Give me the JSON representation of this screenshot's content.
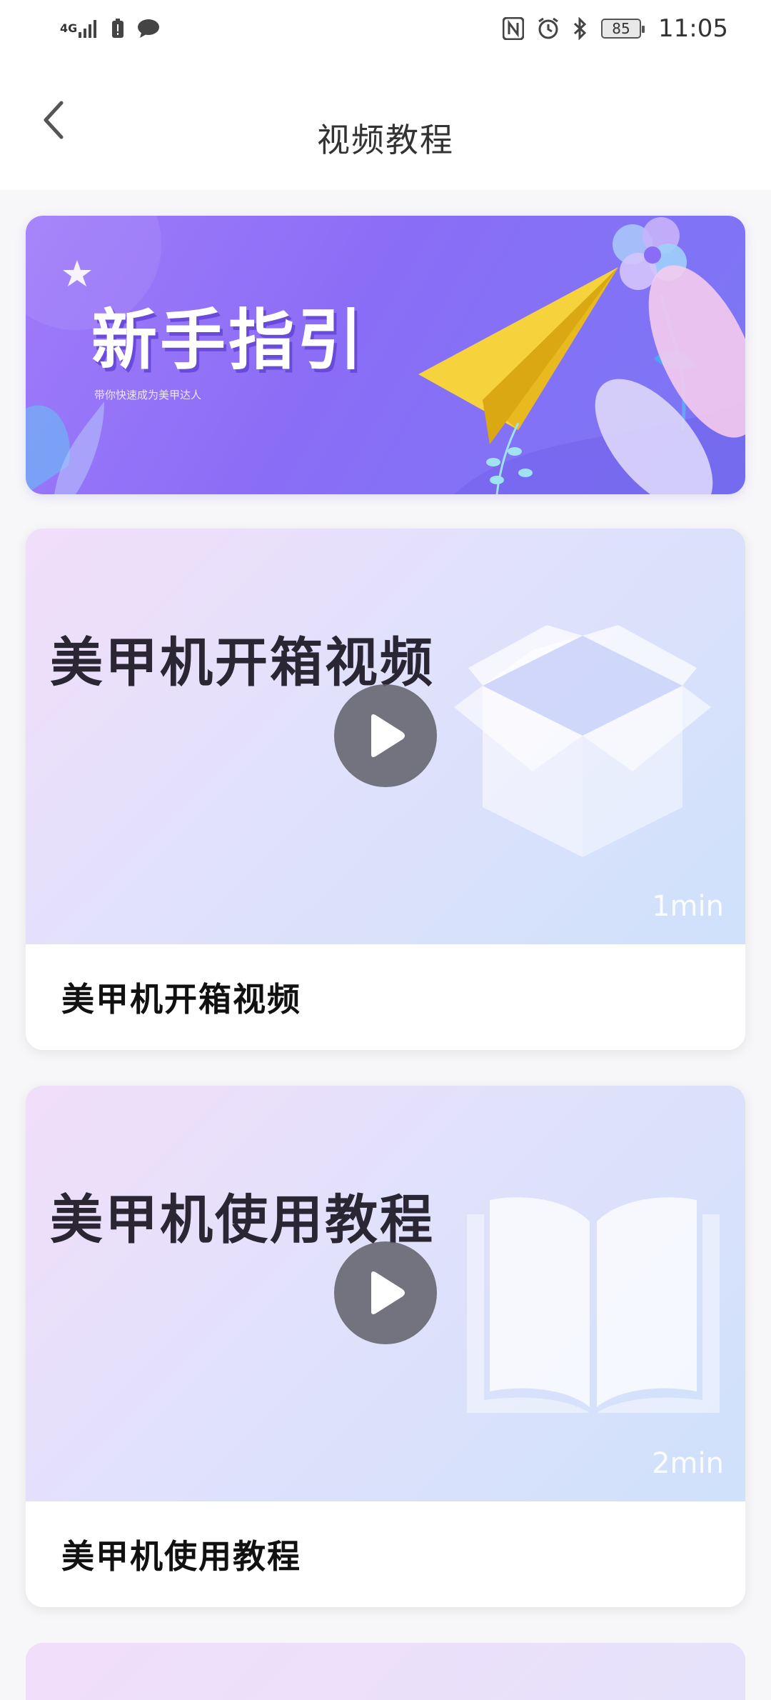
{
  "status_bar": {
    "network": "4G",
    "battery": "85",
    "time": "11:05"
  },
  "header": {
    "title": "视频教程"
  },
  "banner": {
    "title": "新手指引",
    "subtitle": "带你快速成为美甲达人"
  },
  "videos": [
    {
      "thumb_title": "美甲机开箱视频",
      "duration": "1min",
      "caption": "美甲机开箱视频",
      "art": "box-icon"
    },
    {
      "thumb_title": "美甲机使用教程",
      "duration": "2min",
      "caption": "美甲机使用教程",
      "art": "book-icon"
    }
  ],
  "colors": {
    "banner_start": "#a07bfa",
    "banner_end": "#7a78f5",
    "play_button": "#5f5f69",
    "paper_plane": "#f6d23d"
  }
}
